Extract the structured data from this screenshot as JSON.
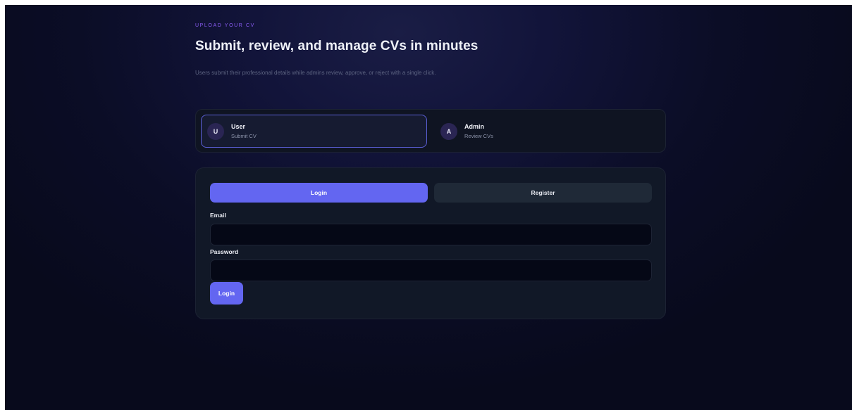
{
  "hero": {
    "eyebrow": "UPLOAD YOUR CV",
    "title": "Submit, review, and manage CVs in minutes",
    "subtitle": "Users submit their professional details while admins review, approve, or reject with a single click."
  },
  "roles": [
    {
      "initial": "U",
      "name": "User",
      "description": "Submit CV",
      "selected": true
    },
    {
      "initial": "A",
      "name": "Admin",
      "description": "Review CVs",
      "selected": false
    }
  ],
  "auth": {
    "tabs": [
      {
        "label": "Login",
        "active": true
      },
      {
        "label": "Register",
        "active": false
      }
    ],
    "email_label": "Email",
    "email_value": "",
    "email_placeholder": "",
    "password_label": "Password",
    "password_value": "",
    "password_placeholder": "",
    "submit_label": "Login"
  },
  "colors": {
    "accent": "#6366f1",
    "eyebrow": "#8b5cf6",
    "background": "#0b0d26",
    "card": "#111827",
    "input": "#050816"
  }
}
